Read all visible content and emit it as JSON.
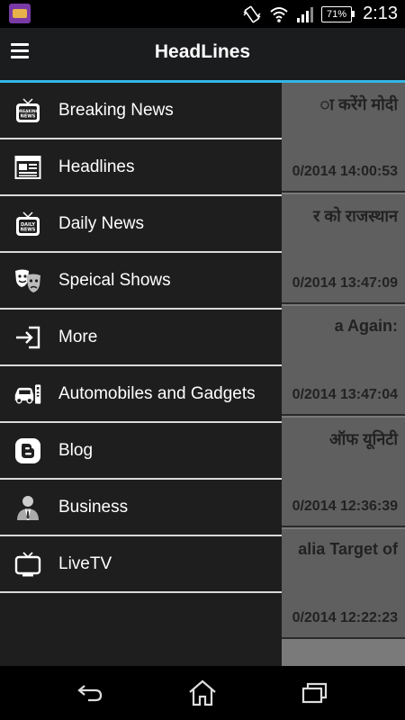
{
  "status_bar": {
    "battery_percent": "71%",
    "time": "2:13"
  },
  "action_bar": {
    "title": "HeadLines"
  },
  "background_list": [
    {
      "headline": "ा करेंगे मोदी",
      "timestamp": "0/2014 14:00:53"
    },
    {
      "headline": "र को राजस्थान",
      "timestamp": "0/2014 13:47:09"
    },
    {
      "headline": "a Again:",
      "timestamp": "0/2014 13:47:04"
    },
    {
      "headline": "ऑफ यूनिटी",
      "timestamp": "0/2014 12:36:39"
    },
    {
      "headline": "alia Target of",
      "timestamp": "0/2014 12:22:23"
    }
  ],
  "drawer": {
    "items": [
      {
        "label": "Breaking News",
        "icon": "breaking-news-tv-icon"
      },
      {
        "label": "Headlines",
        "icon": "newspaper-icon"
      },
      {
        "label": "Daily News",
        "icon": "daily-news-tv-icon"
      },
      {
        "label": "Speical Shows",
        "icon": "theater-masks-icon"
      },
      {
        "label": "More",
        "icon": "sign-in-arrow-icon"
      },
      {
        "label": "Automobiles and Gadgets",
        "icon": "car-remote-icon"
      },
      {
        "label": "Blog",
        "icon": "blogger-icon"
      },
      {
        "label": "Business",
        "icon": "businessman-icon"
      },
      {
        "label": "LiveTV",
        "icon": "tv-icon"
      }
    ]
  },
  "colors": {
    "accent": "#33b5e5",
    "drawer_bg": "#1e1e1e",
    "action_bar_bg": "#1b1c1e"
  }
}
